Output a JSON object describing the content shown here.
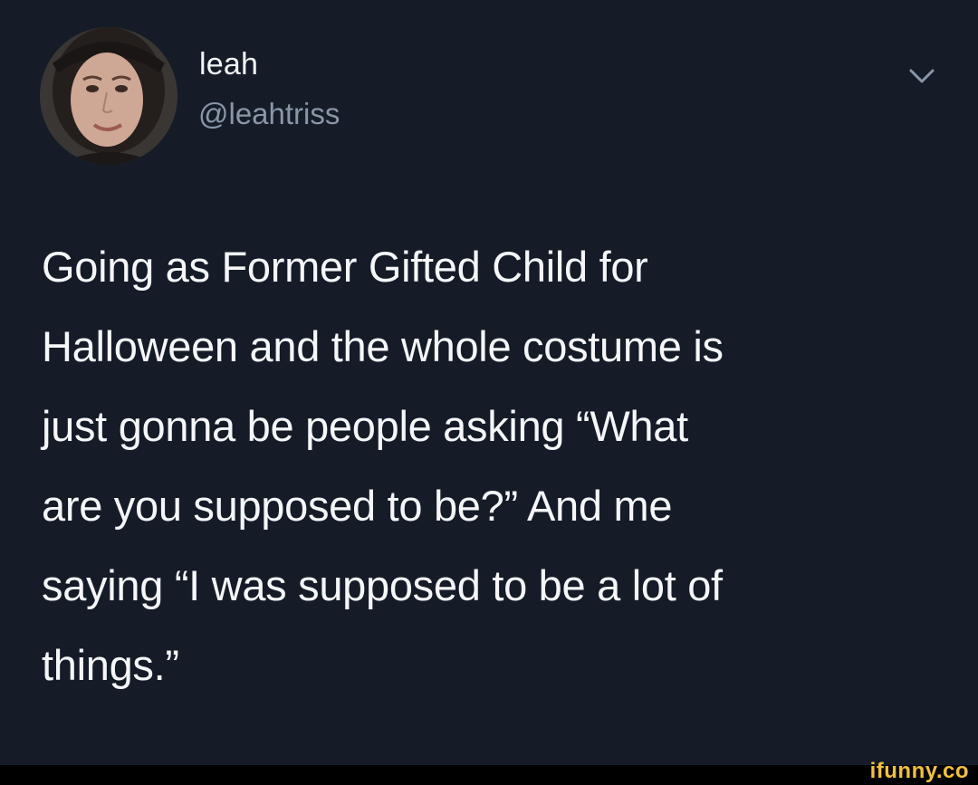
{
  "author": {
    "display_name": "leah",
    "handle": "@leahtriss",
    "avatar_icon": "profile-photo"
  },
  "menu": {
    "icon": "chevron-down-icon"
  },
  "tweet": {
    "text": "Going as Former Gifted Child for\nHalloween and the whole costume is\njust gonna be people asking “What\nare you supposed to be?” And me\nsaying “I was supposed to be a lot of\nthings.”"
  },
  "watermark": {
    "text": "ifunny.co"
  },
  "colors": {
    "tweet_background": "#151c28",
    "primary_text": "#f4f6f8",
    "secondary_text": "#8a96a8",
    "watermark": "#f2c230",
    "frame": "#000000"
  }
}
